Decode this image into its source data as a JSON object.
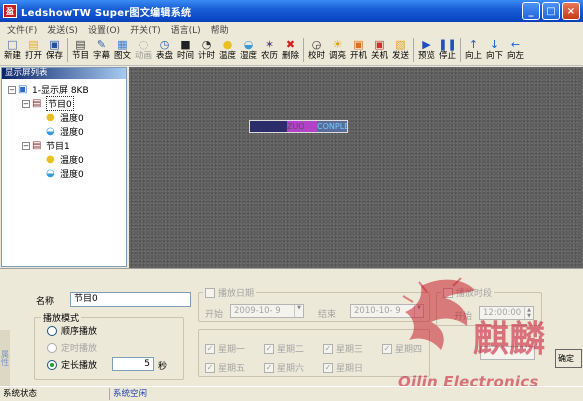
{
  "titlebar": {
    "app_icon_glyph": "盈",
    "title": "LedshowTW Super图文编辑系统",
    "controls": [
      "_",
      "□",
      "×"
    ]
  },
  "menu": [
    "文件(F)",
    "发送(S)",
    "设置(O)",
    "开关(T)",
    "语言(L)",
    "帮助"
  ],
  "toolbar": [
    {
      "label": "新建",
      "icon": "new-file-icon",
      "glyph": "□",
      "color": "#4a6fb0"
    },
    {
      "label": "打开",
      "icon": "open-folder-icon",
      "glyph": "▤",
      "color": "#e0b020"
    },
    {
      "label": "保存",
      "icon": "save-disk-icon",
      "glyph": "▣",
      "color": "#2a4fa0"
    },
    {
      "sep": true
    },
    {
      "label": "节目",
      "icon": "program-icon",
      "glyph": "▤",
      "color": "#444444"
    },
    {
      "label": "字幕",
      "icon": "caption-icon",
      "glyph": "✎",
      "color": "#3060b0"
    },
    {
      "label": "图文",
      "icon": "image-text-icon",
      "glyph": "▦",
      "color": "#3a7bd5"
    },
    {
      "label": "动画",
      "icon": "animation-icon",
      "glyph": "◌",
      "color": "#9a9a9a",
      "disabled": true
    },
    {
      "label": "表盘",
      "icon": "clock-dial-icon",
      "glyph": "◷",
      "color": "#2060c0"
    },
    {
      "label": "时间",
      "icon": "time-icon",
      "glyph": "■",
      "color": "#222222"
    },
    {
      "label": "计时",
      "icon": "timer-icon",
      "glyph": "◔",
      "color": "#333333"
    },
    {
      "label": "温度",
      "icon": "temperature-icon",
      "glyph": "●",
      "color": "#e8c020"
    },
    {
      "label": "湿度",
      "icon": "humidity-icon",
      "glyph": "◒",
      "color": "#3a9ad8"
    },
    {
      "label": "农历",
      "icon": "lunar-calendar-icon",
      "glyph": "✶",
      "color": "#6040a0"
    },
    {
      "label": "删除",
      "icon": "delete-icon",
      "glyph": "✖",
      "color": "#d02020"
    },
    {
      "sep": true
    },
    {
      "label": "校时",
      "icon": "calibrate-time-icon",
      "glyph": "◶",
      "color": "#333333"
    },
    {
      "label": "调亮",
      "icon": "brightness-icon",
      "glyph": "☀",
      "color": "#e0a000"
    },
    {
      "label": "开机",
      "icon": "power-on-icon",
      "glyph": "▣",
      "color": "#e07020"
    },
    {
      "label": "关机",
      "icon": "power-off-icon",
      "glyph": "▣",
      "color": "#d03030"
    },
    {
      "label": "发送",
      "icon": "send-icon",
      "glyph": "▧",
      "color": "#e0a030"
    },
    {
      "sep": true
    },
    {
      "label": "预览",
      "icon": "preview-play-icon",
      "glyph": "▶",
      "color": "#2050c0"
    },
    {
      "label": "停止",
      "icon": "stop-icon",
      "glyph": "❚❚",
      "color": "#2050c0"
    },
    {
      "sep": true
    },
    {
      "label": "向上",
      "icon": "move-up-icon",
      "glyph": "↑",
      "color": "#1a5fd0"
    },
    {
      "label": "向下",
      "icon": "move-down-icon",
      "glyph": "↓",
      "color": "#1a5fd0"
    },
    {
      "label": "向左",
      "icon": "move-left-icon",
      "glyph": "←",
      "color": "#1a5fd0"
    }
  ],
  "tree": {
    "header": "显示屏列表",
    "rows": [
      {
        "text": "1-显示屏  8KB",
        "level": 0,
        "toggle": "−",
        "icon": "display-screen-icon",
        "glyph": "▣",
        "color": "#2c6cc8"
      },
      {
        "text": "节目0",
        "level": 1,
        "toggle": "−",
        "icon": "program-icon",
        "glyph": "▤",
        "color": "#7a3030",
        "selected": true
      },
      {
        "text": "温度0",
        "level": 2,
        "icon": "temperature-icon",
        "glyph": "●",
        "color": "#e8c020"
      },
      {
        "text": "湿度0",
        "level": 2,
        "icon": "humidity-icon",
        "glyph": "◒",
        "color": "#3a9ad8"
      },
      {
        "text": "节目1",
        "level": 1,
        "toggle": "−",
        "icon": "program-icon",
        "glyph": "▤",
        "color": "#7a3030"
      },
      {
        "text": "温度0",
        "level": 2,
        "icon": "temperature-icon",
        "glyph": "●",
        "color": "#e8c020"
      },
      {
        "text": "湿度0",
        "level": 2,
        "icon": "humidity-icon",
        "glyph": "◒",
        "color": "#3a9ad8"
      }
    ]
  },
  "preview": {
    "segment2": "ZUO",
    "segment3": "CONPLE"
  },
  "props": {
    "side_tab": "属性",
    "name_label": "名称",
    "name_value": "节目0",
    "play_mode_title": "播放模式",
    "mode_sequential": "顺序播放",
    "mode_timed": "定时播放",
    "mode_fixed_length": "定长播放",
    "fixed_length_value": "5",
    "seconds_unit": "秒",
    "schedule_checkbox": "播放日期",
    "start_label": "开始",
    "start_value": "2009-10-  9",
    "end_label": "结束",
    "end_value": "2010-10-  9",
    "time_period_title": "播放时段",
    "start_time_label": "开始",
    "start_time_value": "12:00:00",
    "weekdays_row1": [
      "星期一",
      "星期二",
      "星期三",
      "星期四"
    ],
    "weekdays_row2": [
      "星期五",
      "星期六",
      "星期日"
    ],
    "confirm_button": "确定"
  },
  "statusbar": {
    "label": "系统状态",
    "value": "系统空闲"
  },
  "watermark": {
    "company_name": "麒麟",
    "text": "Qilin Electronics"
  }
}
